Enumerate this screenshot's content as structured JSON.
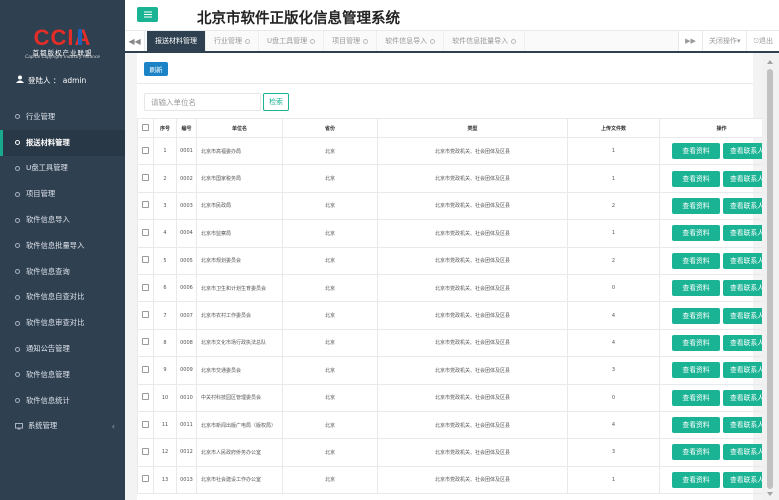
{
  "app": {
    "title": "北京市软件正版化信息管理系统",
    "logo_text": "CCIA",
    "logo_cn": "首都版权产业联盟",
    "logo_en": "Capital Copyright Industry Alliance",
    "user_label": "登陆人 ： admin"
  },
  "sidebar": {
    "items": [
      {
        "label": "行业管理"
      },
      {
        "label": "报送材料管理"
      },
      {
        "label": "U盘工具管理"
      },
      {
        "label": "项目管理"
      },
      {
        "label": "软件信息导入"
      },
      {
        "label": "软件信息批量导入"
      },
      {
        "label": "软件信息查询"
      },
      {
        "label": "软件信息自查对比"
      },
      {
        "label": "软件信息审查对比"
      },
      {
        "label": "通知公告管理"
      },
      {
        "label": "软件信息管理"
      },
      {
        "label": "软件信息统计"
      },
      {
        "label": "系统管理"
      }
    ]
  },
  "tabs": {
    "items": [
      {
        "label": "报送材料管理"
      },
      {
        "label": "行业管理"
      },
      {
        "label": "U盘工具管理"
      },
      {
        "label": "项目管理"
      },
      {
        "label": "软件信息导入"
      },
      {
        "label": "软件信息批量导入"
      }
    ],
    "close_ops": "关闭操作",
    "logout": "退出"
  },
  "toolbar": {
    "refresh_label": "刷新",
    "search_placeholder": "请输入单位名",
    "search_label": "检索"
  },
  "table": {
    "headers": [
      "",
      "序号",
      "编号",
      "单位名",
      "省份",
      "类型",
      "上传文件数",
      "操作"
    ],
    "view_label": "查看资料",
    "contact_label": "查看联系人",
    "rows": [
      {
        "seq": "1",
        "code": "0001",
        "name": "北京市高福委办局",
        "province": "北京",
        "type": "北京市党政机关、社会团体及区县",
        "files": "1"
      },
      {
        "seq": "2",
        "code": "0002",
        "name": "北京市国家税务局",
        "province": "北京",
        "type": "北京市党政机关、社会团体及区县",
        "files": "1"
      },
      {
        "seq": "3",
        "code": "0003",
        "name": "北京市民政局",
        "province": "北京",
        "type": "北京市党政机关、社会团体及区县",
        "files": "2"
      },
      {
        "seq": "4",
        "code": "0004",
        "name": "北京市监察局",
        "province": "北京",
        "type": "北京市党政机关、社会团体及区县",
        "files": "1"
      },
      {
        "seq": "5",
        "code": "0005",
        "name": "北京市规划委员会",
        "province": "北京",
        "type": "北京市党政机关、社会团体及区县",
        "files": "2"
      },
      {
        "seq": "6",
        "code": "0006",
        "name": "北京市卫生和计划生育委员会",
        "province": "北京",
        "type": "北京市党政机关、社会团体及区县",
        "files": "0"
      },
      {
        "seq": "7",
        "code": "0007",
        "name": "北京市农村工作委员会",
        "province": "北京",
        "type": "北京市党政机关、社会团体及区县",
        "files": "4"
      },
      {
        "seq": "8",
        "code": "0008",
        "name": "北京市文化市场行政执法总队",
        "province": "北京",
        "type": "北京市党政机关、社会团体及区县",
        "files": "4"
      },
      {
        "seq": "9",
        "code": "0009",
        "name": "北京市交通委员会",
        "province": "北京",
        "type": "北京市党政机关、社会团体及区县",
        "files": "3"
      },
      {
        "seq": "10",
        "code": "0010",
        "name": "中关村科技园区管理委员会",
        "province": "北京",
        "type": "北京市党政机关、社会团体及区县",
        "files": "0"
      },
      {
        "seq": "11",
        "code": "0011",
        "name": "北京市新闻出版广电局（版权局）",
        "province": "北京",
        "type": "北京市党政机关、社会团体及区县",
        "files": "4"
      },
      {
        "seq": "12",
        "code": "0012",
        "name": "北京市人民政府侨务办公室",
        "province": "北京",
        "type": "北京市党政机关、社会团体及区县",
        "files": "3"
      },
      {
        "seq": "13",
        "code": "0013",
        "name": "北京市社会建设工作办公室",
        "province": "北京",
        "type": "北京市党政机关、社会团体及区县",
        "files": "1"
      }
    ]
  },
  "colors": {
    "sidebar_bg": "#2f4050",
    "accent_green": "#1ab394",
    "accent_blue": "#1c84c6",
    "logo_red": "#e52d27",
    "logo_blue": "#1f5fb2"
  }
}
